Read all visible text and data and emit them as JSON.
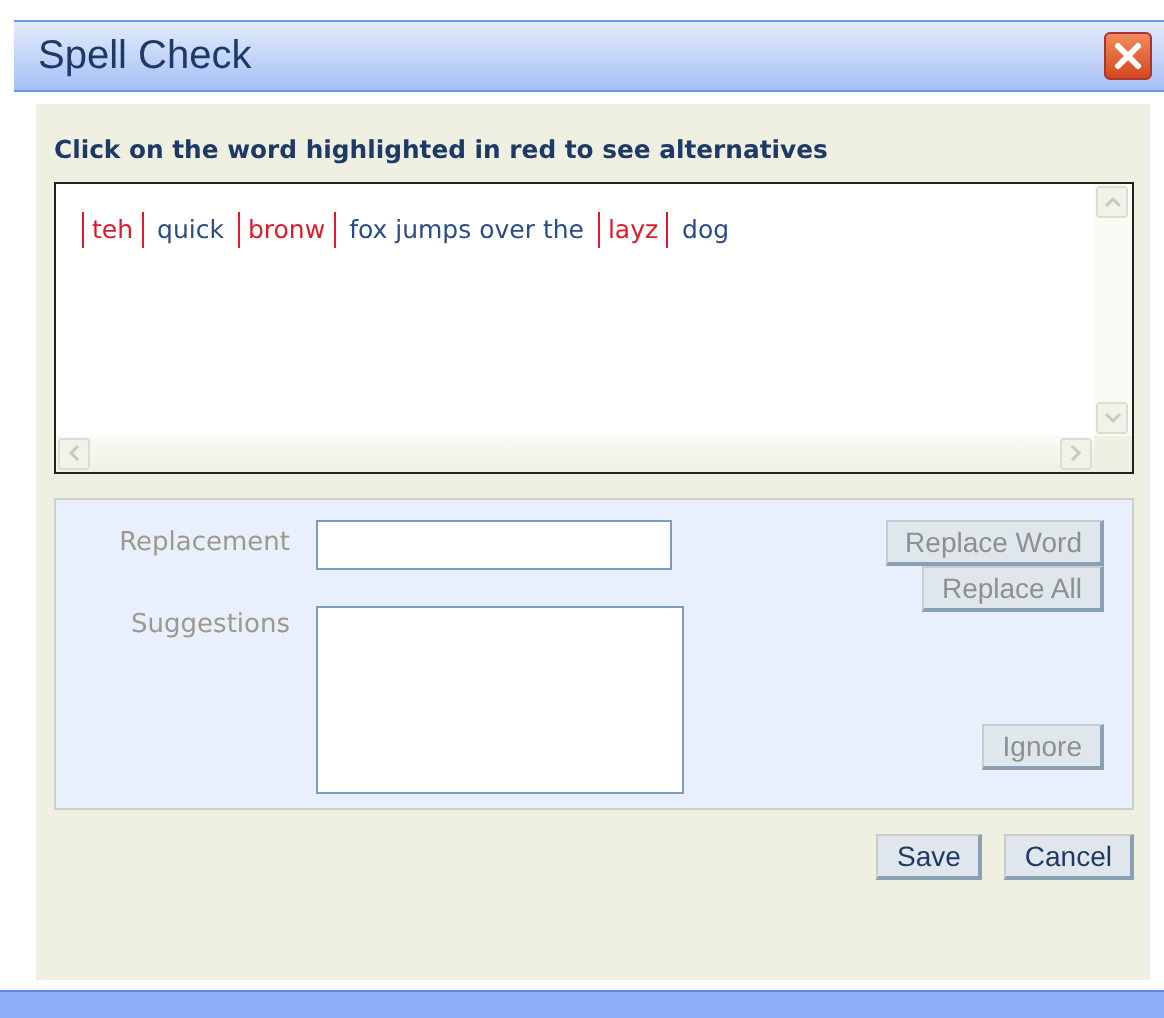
{
  "window": {
    "title": "Spell Check"
  },
  "instruction": "Click on the word highlighted in red to see alternatives",
  "words": [
    {
      "text": "teh",
      "misspelled": true
    },
    {
      "text": "quick",
      "misspelled": false
    },
    {
      "text": "bronw",
      "misspelled": true
    },
    {
      "text": "fox jumps over the",
      "misspelled": false
    },
    {
      "text": "layz",
      "misspelled": true
    },
    {
      "text": "dog",
      "misspelled": false
    }
  ],
  "replacement": {
    "label": "Replacement",
    "disabled": true
  },
  "suggestions": {
    "label": "Suggestions",
    "disabled": true
  },
  "actions": [
    {
      "label": "Replace Word",
      "disabled": true
    },
    {
      "label": "Replace All",
      "disabled": true
    },
    {
      "label": "Ignore",
      "disabled": true
    }
  ],
  "buttons": [
    {
      "label": "Save",
      "disabled": false
    },
    {
      "label": "Cancel",
      "disabled": false
    }
  ]
}
